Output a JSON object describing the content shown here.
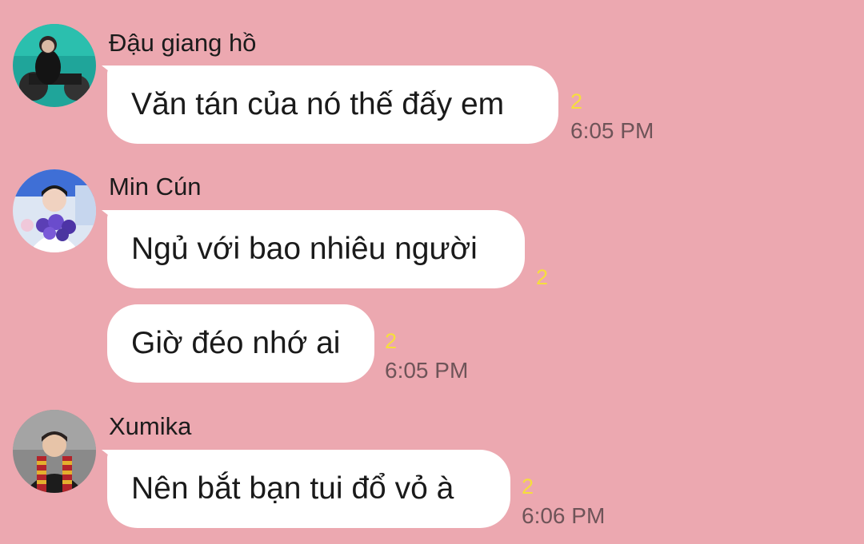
{
  "theme": {
    "background": "#eca8b0",
    "bubble": "#ffffff",
    "unread_color": "#f6de3c",
    "time_color": "#6e5458"
  },
  "messages": [
    {
      "sender": "Đậu giang hồ",
      "avatar": "avatar-teal-motorbike",
      "bubbles": [
        {
          "text": "Văn tán của nó thế đấy em",
          "unread": "2",
          "time": "6:05 PM"
        }
      ]
    },
    {
      "sender": "Min Cún",
      "avatar": "avatar-flowers-bouquet",
      "bubbles": [
        {
          "text": "Ngủ với bao nhiêu người",
          "unread": "2"
        },
        {
          "text": "Giờ đéo nhớ ai",
          "unread": "2",
          "time": "6:05 PM"
        }
      ]
    },
    {
      "sender": "Xumika",
      "avatar": "avatar-striped-scarf",
      "bubbles": [
        {
          "text": "Nên bắt bạn tui đổ vỏ à",
          "unread": "2",
          "time": "6:06 PM"
        }
      ]
    }
  ]
}
